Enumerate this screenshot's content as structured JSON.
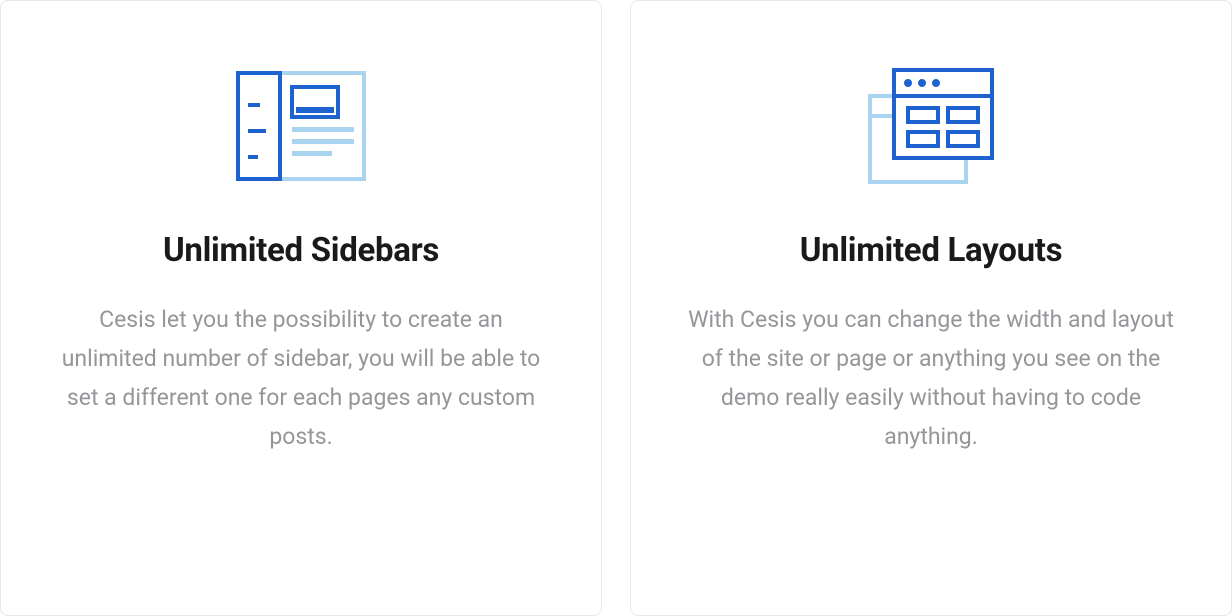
{
  "cards": [
    {
      "title": "Unlimited Sidebars",
      "description": "Cesis let you the possibility to create an unlimited number of sidebar, you will be able to set a different one for each pages any custom posts."
    },
    {
      "title": "Unlimited Layouts",
      "description": "With Cesis you can change the width and layout of the site or page or anything you see on the demo really easily without having to code anything."
    }
  ],
  "colors": {
    "primary": "#1e62d0",
    "light": "#a8d4ef",
    "text_dark": "#1a1a1a",
    "text_muted": "#94969a"
  }
}
